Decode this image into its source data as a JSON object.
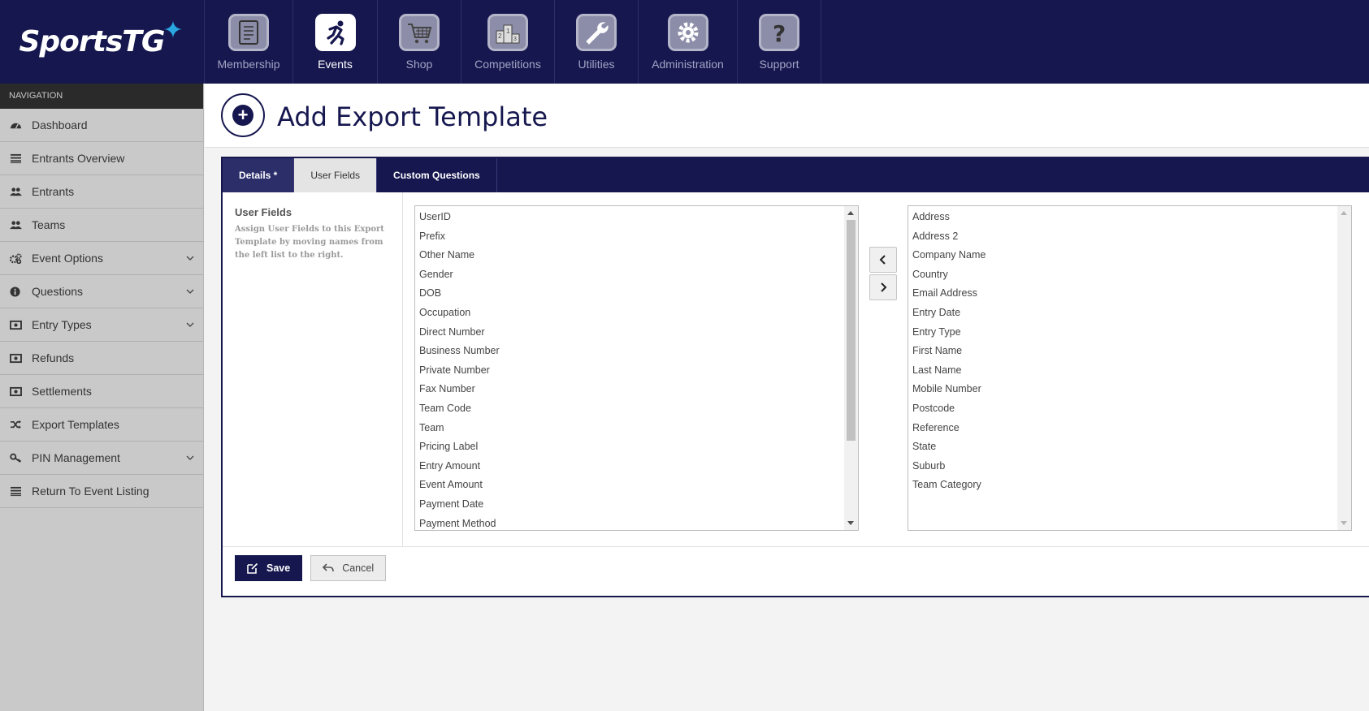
{
  "app": {
    "logo_text": "SportsTG",
    "colors": {
      "primary": "#16174f",
      "accent": "#2aa7e0",
      "sidebar": "#c9c9c9"
    }
  },
  "modules": [
    {
      "label": "Membership",
      "icon": "clipboard-icon",
      "active": false
    },
    {
      "label": "Events",
      "icon": "runner-icon",
      "active": true
    },
    {
      "label": "Shop",
      "icon": "cart-icon",
      "active": false
    },
    {
      "label": "Competitions",
      "icon": "podium-icon",
      "active": false
    },
    {
      "label": "Utilities",
      "icon": "wrench-icon",
      "active": false
    },
    {
      "label": "Administration",
      "icon": "gear-icon",
      "active": false
    },
    {
      "label": "Support",
      "icon": "question-icon",
      "active": false
    }
  ],
  "sidebar": {
    "heading": "NAVIGATION",
    "items": [
      {
        "label": "Dashboard",
        "icon": "dashboard-icon",
        "has_children": false
      },
      {
        "label": "Entrants Overview",
        "icon": "list-icon",
        "has_children": false
      },
      {
        "label": "Entrants",
        "icon": "users-icon",
        "has_children": false
      },
      {
        "label": "Teams",
        "icon": "users-icon",
        "has_children": false
      },
      {
        "label": "Event Options",
        "icon": "cogs-icon",
        "has_children": true
      },
      {
        "label": "Questions",
        "icon": "info-icon",
        "has_children": true
      },
      {
        "label": "Entry Types",
        "icon": "money-icon",
        "has_children": true
      },
      {
        "label": "Refunds",
        "icon": "money-icon",
        "has_children": false
      },
      {
        "label": "Settlements",
        "icon": "money-icon",
        "has_children": false
      },
      {
        "label": "Export Templates",
        "icon": "shuffle-icon",
        "has_children": false
      },
      {
        "label": "PIN Management",
        "icon": "key-icon",
        "has_children": true
      },
      {
        "label": "Return To Event Listing",
        "icon": "list-icon",
        "has_children": false
      }
    ]
  },
  "page": {
    "title": "Add Export Template",
    "title_icon": "add-circle-icon"
  },
  "tabs": [
    {
      "label": "Details *",
      "active": false
    },
    {
      "label": "User Fields",
      "active": true
    },
    {
      "label": "Custom Questions",
      "active": false
    }
  ],
  "user_fields": {
    "title": "User Fields",
    "description": "Assign User Fields to this Export Template by moving names from the left list to the right.",
    "available": [
      "UserID",
      "Prefix",
      "Other Name",
      "Gender",
      "DOB",
      "Occupation",
      "Direct Number",
      "Business Number",
      "Private Number",
      "Fax Number",
      "Team Code",
      "Team",
      "Pricing Label",
      "Entry Amount",
      "Event Amount",
      "Payment Date",
      "Payment Method"
    ],
    "selected": [
      "Address",
      "Address 2",
      "Company Name",
      "Country",
      "Email Address",
      "Entry Date",
      "Entry Type",
      "First Name",
      "Last Name",
      "Mobile Number",
      "Postcode",
      "Reference",
      "State",
      "Suburb",
      "Team Category"
    ],
    "move_left_icon": "chevron-left-icon",
    "move_right_icon": "chevron-right-icon"
  },
  "actions": {
    "save_label": "Save",
    "cancel_label": "Cancel"
  }
}
